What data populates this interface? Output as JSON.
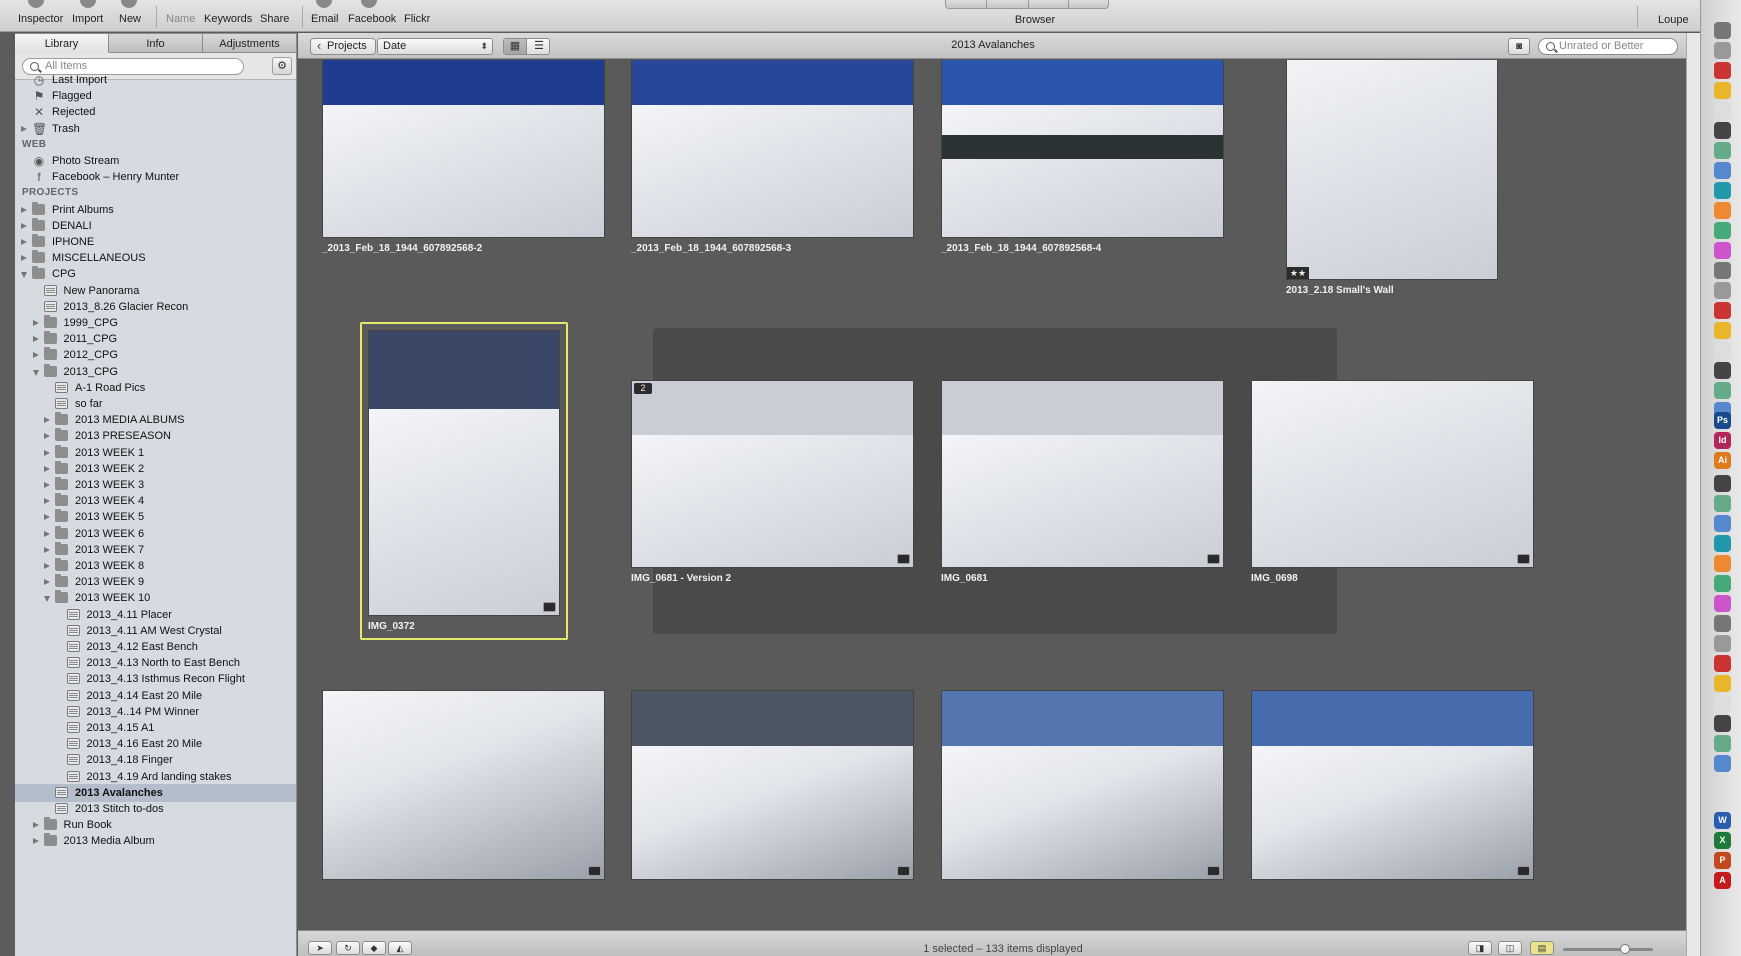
{
  "toolbar": {
    "inspector": "Inspector",
    "import": "Import",
    "new": "New",
    "name": "Name",
    "keywords": "Keywords",
    "share": "Share",
    "email": "Email",
    "facebook": "Facebook",
    "flickr": "Flickr",
    "browser": "Browser",
    "loupe": "Loupe"
  },
  "sidebar": {
    "tabs": [
      "Library",
      "Info",
      "Adjustments"
    ],
    "search_placeholder": "All Items",
    "gear": "⚙",
    "items": [
      {
        "label": "Last Import",
        "kind": "glyph",
        "glyph": "◷",
        "indent": 0,
        "tri": "none"
      },
      {
        "label": "Flagged",
        "kind": "glyph",
        "glyph": "⚑",
        "indent": 0,
        "tri": "none"
      },
      {
        "label": "Rejected",
        "kind": "glyph",
        "glyph": "✕",
        "indent": 0,
        "tri": "none"
      },
      {
        "label": "Trash",
        "kind": "glyph",
        "glyph": "🗑",
        "indent": 0,
        "tri": "closed"
      },
      {
        "label": "WEB",
        "kind": "header"
      },
      {
        "label": "Photo Stream",
        "kind": "glyph",
        "glyph": "◉",
        "indent": 0,
        "tri": "none"
      },
      {
        "label": "Facebook – Henry Munter",
        "kind": "glyph",
        "glyph": "f",
        "indent": 0,
        "tri": "none"
      },
      {
        "label": "PROJECTS",
        "kind": "header"
      },
      {
        "label": "Print Albums",
        "kind": "folder",
        "indent": 0,
        "tri": "closed"
      },
      {
        "label": "DENALI",
        "kind": "folder",
        "indent": 0,
        "tri": "closed"
      },
      {
        "label": "IPHONE",
        "kind": "folder",
        "indent": 0,
        "tri": "closed"
      },
      {
        "label": "MISCELLANEOUS",
        "kind": "folder",
        "indent": 0,
        "tri": "closed"
      },
      {
        "label": "CPG",
        "kind": "folder",
        "indent": 0,
        "tri": "open"
      },
      {
        "label": "New Panorama",
        "kind": "album",
        "indent": 1,
        "tri": "none"
      },
      {
        "label": "2013_8.26 Glacier Recon",
        "kind": "album",
        "indent": 1,
        "tri": "none"
      },
      {
        "label": "1999_CPG",
        "kind": "folder",
        "indent": 1,
        "tri": "closed"
      },
      {
        "label": "2011_CPG",
        "kind": "folder",
        "indent": 1,
        "tri": "closed"
      },
      {
        "label": "2012_CPG",
        "kind": "folder",
        "indent": 1,
        "tri": "closed"
      },
      {
        "label": "2013_CPG",
        "kind": "folder",
        "indent": 1,
        "tri": "open"
      },
      {
        "label": "A-1 Road Pics",
        "kind": "album",
        "indent": 2,
        "tri": "none"
      },
      {
        "label": "so far",
        "kind": "album",
        "indent": 2,
        "tri": "none"
      },
      {
        "label": "2013 MEDIA ALBUMS",
        "kind": "folder",
        "indent": 2,
        "tri": "closed"
      },
      {
        "label": "2013 PRESEASON",
        "kind": "folder",
        "indent": 2,
        "tri": "closed"
      },
      {
        "label": "2013 WEEK 1",
        "kind": "folder",
        "indent": 2,
        "tri": "closed"
      },
      {
        "label": "2013 WEEK 2",
        "kind": "folder",
        "indent": 2,
        "tri": "closed"
      },
      {
        "label": "2013 WEEK 3",
        "kind": "folder",
        "indent": 2,
        "tri": "closed"
      },
      {
        "label": "2013 WEEK 4",
        "kind": "folder",
        "indent": 2,
        "tri": "closed"
      },
      {
        "label": "2013 WEEK 5",
        "kind": "folder",
        "indent": 2,
        "tri": "closed"
      },
      {
        "label": "2013 WEEK 6",
        "kind": "folder",
        "indent": 2,
        "tri": "closed"
      },
      {
        "label": "2013 WEEK 7",
        "kind": "folder",
        "indent": 2,
        "tri": "closed"
      },
      {
        "label": "2013 WEEK 8",
        "kind": "folder",
        "indent": 2,
        "tri": "closed"
      },
      {
        "label": "2013 WEEK 9",
        "kind": "folder",
        "indent": 2,
        "tri": "closed"
      },
      {
        "label": "2013 WEEK 10",
        "kind": "folder",
        "indent": 2,
        "tri": "open"
      },
      {
        "label": "2013_4.11 Placer",
        "kind": "album",
        "indent": 3,
        "tri": "none"
      },
      {
        "label": "2013_4.11 AM West Crystal",
        "kind": "album",
        "indent": 3,
        "tri": "none"
      },
      {
        "label": "2013_4.12 East Bench",
        "kind": "album",
        "indent": 3,
        "tri": "none"
      },
      {
        "label": "2013_4.13 North to East Bench",
        "kind": "album",
        "indent": 3,
        "tri": "none"
      },
      {
        "label": "2013_4.13 Isthmus Recon Flight",
        "kind": "album",
        "indent": 3,
        "tri": "none"
      },
      {
        "label": "2013_4.14 East 20 Mile",
        "kind": "album",
        "indent": 3,
        "tri": "none"
      },
      {
        "label": "2013_4..14 PM Winner",
        "kind": "album",
        "indent": 3,
        "tri": "none"
      },
      {
        "label": "2013_4.15 A1",
        "kind": "album",
        "indent": 3,
        "tri": "none"
      },
      {
        "label": "2013_4.16 East 20 Mile",
        "kind": "album",
        "indent": 3,
        "tri": "none"
      },
      {
        "label": "2013_4.18 Finger",
        "kind": "album",
        "indent": 3,
        "tri": "none"
      },
      {
        "label": "2013_4.19 Ard landing stakes",
        "kind": "album",
        "indent": 3,
        "tri": "none"
      },
      {
        "label": "2013 Avalanches",
        "kind": "album",
        "indent": 2,
        "tri": "none",
        "selected": true
      },
      {
        "label": "2013 Stitch to-dos",
        "kind": "album",
        "indent": 2,
        "tri": "none"
      },
      {
        "label": "Run Book",
        "kind": "folder",
        "indent": 1,
        "tri": "closed"
      },
      {
        "label": "2013 Media Album",
        "kind": "folder",
        "indent": 1,
        "tri": "closed"
      }
    ]
  },
  "browser": {
    "projects_button": "Projects",
    "sort_select": "Date",
    "title": "2013 Avalanches",
    "rating_filter_placeholder": "Unrated or Better",
    "status": "1 selected – 133 items displayed"
  },
  "photos": [
    {
      "caption": "_2013_Feb_18_1944_607892568-2",
      "sky": "#1f3d8f",
      "stars": "",
      "stack": ""
    },
    {
      "caption": "_2013_Feb_18_1944_607892568-3",
      "sky": "#27479a",
      "stars": "",
      "stack": ""
    },
    {
      "caption": "_2013_Feb_18_1944_607892568-4",
      "sky": "#2c55ad",
      "stars": "",
      "stack": ""
    },
    {
      "caption": "2013_2.18 Small's Wall",
      "sky": "#c9c6d4",
      "stars": "★★",
      "stack": ""
    },
    {
      "caption": "IMG_0372",
      "sky": "#3a4766",
      "stars": "",
      "stack": ""
    },
    {
      "caption": "IMG_0681 - Version 2",
      "sky": "#c8cdd6",
      "stars": "",
      "stack": "2"
    },
    {
      "caption": "IMG_0681",
      "sky": "#c8cdd6",
      "stars": "",
      "stack": ""
    },
    {
      "caption": "IMG_0698",
      "sky": "#cfcfcf",
      "stars": "",
      "stack": ""
    },
    {
      "caption": "",
      "sky": "#8a8a8a",
      "stars": "",
      "stack": ""
    },
    {
      "caption": "",
      "sky": "#4c5563",
      "stars": "",
      "stack": ""
    },
    {
      "caption": "",
      "sky": "#5476b0",
      "stars": "",
      "stack": ""
    },
    {
      "caption": "",
      "sky": "#476cae",
      "stars": "",
      "stack": ""
    }
  ],
  "dock": [
    {
      "name": "ps-app-icon",
      "label": "Ps",
      "color": "#1b4a8a"
    },
    {
      "name": "id-app-icon",
      "label": "Id",
      "color": "#b3265a"
    },
    {
      "name": "ai-app-icon",
      "label": "Ai",
      "color": "#e07b1c"
    },
    {
      "name": "word-app-icon",
      "label": "W",
      "color": "#2a5db0"
    },
    {
      "name": "excel-app-icon",
      "label": "X",
      "color": "#1f7a3a"
    },
    {
      "name": "powerpoint-app-icon",
      "label": "P",
      "color": "#c2481e"
    },
    {
      "name": "acrobat-app-icon",
      "label": "A",
      "color": "#c21c1c"
    }
  ]
}
